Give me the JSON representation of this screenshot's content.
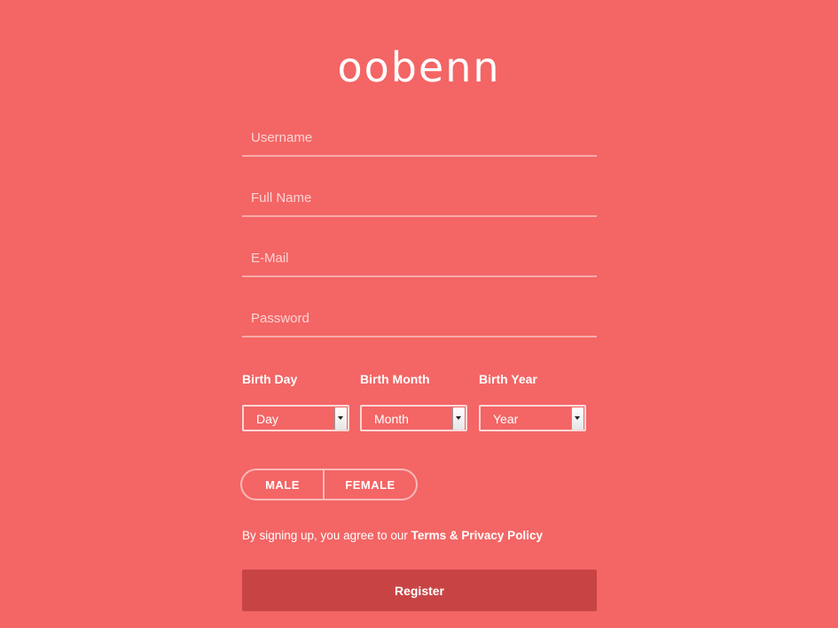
{
  "brand": {
    "logo_text": "oobenn"
  },
  "form": {
    "fields": [
      {
        "placeholder": "Username",
        "value": ""
      },
      {
        "placeholder": "Full Name",
        "value": ""
      },
      {
        "placeholder": "E-Mail",
        "value": ""
      },
      {
        "placeholder": "Password",
        "value": ""
      }
    ],
    "birth": {
      "day_label": "Birth Day",
      "month_label": "Birth Month",
      "year_label": "Birth Year",
      "day_selected": "Day",
      "month_selected": "Month",
      "year_selected": "Year"
    },
    "gender": {
      "male_label": "MALE",
      "female_label": "FEMALE"
    },
    "terms": {
      "prefix": "By signing up, you agree to our ",
      "link_text": "Terms & Privacy Policy"
    },
    "register_label": "Register"
  },
  "colors": {
    "background": "#f46565",
    "register_button": "#c84444",
    "text": "#ffffff"
  }
}
